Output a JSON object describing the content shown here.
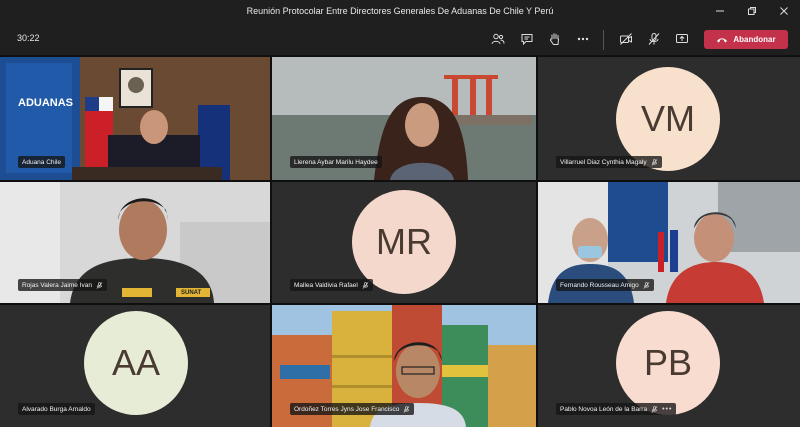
{
  "window": {
    "title": "Reunión Protocolar Entre Directores Generales De Aduanas De Chile Y Perú"
  },
  "toolbar": {
    "timer": "30:22",
    "leave_label": "Abandonar"
  },
  "participants": [
    {
      "name": "Aduana Chile"
    },
    {
      "name": "Llerena Aybar Marilu Haydee"
    },
    {
      "name": "Villarruel Diaz Cynthia Magaly",
      "initials": "VM"
    },
    {
      "name": "Rojas Valera Jaime Ivan"
    },
    {
      "name": "Mallea Valdivia Rafael",
      "initials": "MR"
    },
    {
      "name": "Fernando Rousseau Amigo"
    },
    {
      "name": "Alvarado Burga Arnaldo",
      "initials": "AA"
    },
    {
      "name": "Ordoñez Torres Jyns Jose Francisco"
    },
    {
      "name": "Pablo Novoa León de la Barra",
      "initials": "PB",
      "more": "•••"
    }
  ],
  "scene_text": {
    "banner": "ADUANAS",
    "vest": "SUNAT"
  },
  "colors": {
    "leave": "#c4314b",
    "avatar_vm": "#f8e1cc",
    "avatar_mr": "#f5d8cc",
    "avatar_aa": "#e6ecd6",
    "avatar_pb": "#f8dccf"
  }
}
